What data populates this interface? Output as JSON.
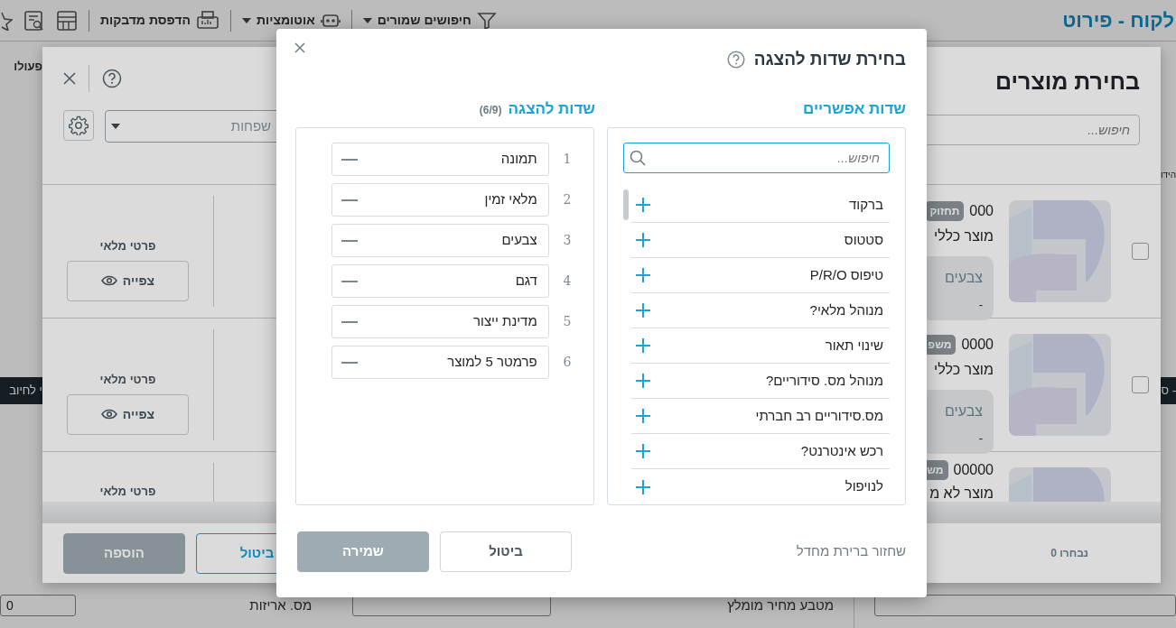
{
  "page": {
    "title": "לקוח - פירוט",
    "toolbar": [
      {
        "kind": "filter",
        "label": "חיפושים שמורים",
        "dropdown": true
      },
      {
        "kind": "robot",
        "label": "אוטומציות",
        "dropdown": true
      },
      {
        "kind": "printer",
        "label": "הדפסת מדבקות",
        "dropdown": false
      },
      {
        "kind": "table"
      },
      {
        "kind": "report"
      },
      {
        "kind": "star"
      }
    ],
    "left_tab": "פעולו",
    "left_banner": "י לחיוב",
    "right_label": "הידו",
    "right_banner": "- ס",
    "footer_fields": [
      {
        "label": "מטבע מחיר מומלץ"
      },
      {
        "label": "מס. אריזות",
        "value": "0"
      }
    ]
  },
  "product_picker": {
    "title": "בחירת מוצרים",
    "search": {
      "placeholder": "חיפוש..."
    },
    "family": {
      "placeholder": "שפחות"
    },
    "rows": [
      {
        "checked": false,
        "code": "000",
        "tag": "תחזוק",
        "name": "מוצר כללי",
        "attr_label": "צבעים",
        "attr_value": "-",
        "stock_label": "פרטי מלאי",
        "view": "צפייה"
      },
      {
        "checked": false,
        "code": "0000",
        "tag": "משפ",
        "name": "מוצר כללי",
        "attr_label": "צבעים",
        "attr_value": "-",
        "stock_label": "פרטי מלאי",
        "view": "צפייה"
      },
      {
        "code": "00000",
        "tag": "מש",
        "name": "מוצר לא מ",
        "stock_label": "פרטי מלאי"
      }
    ],
    "selected_count": "נבחרו 0",
    "buttons": [
      {
        "label": "ביטול",
        "kind": "outline",
        "disabled": false
      },
      {
        "label": "הוספה",
        "kind": "primary",
        "disabled": true
      }
    ]
  },
  "field_picker": {
    "title": "בחירת שדות להצגה",
    "available_title": "שדות אפשריים",
    "shown_title": "שדות להצגה",
    "shown_count": "(6/9)",
    "search": {
      "placeholder": "חיפוש..."
    },
    "available": [
      {
        "label": "ברקוד"
      },
      {
        "label": "סטטוס"
      },
      {
        "label": "טיפוס P/R/O"
      },
      {
        "label": "מנוהל מלאי?"
      },
      {
        "label": "שינוי תאור"
      },
      {
        "label": "מנוהל מס. סידוריים?"
      },
      {
        "label": "מס.סידוריים רב חברתי"
      },
      {
        "label": "רכש אינטרנט?"
      },
      {
        "label": "לנויפול"
      }
    ],
    "shown": [
      {
        "number": "1",
        "label": "תמונה"
      },
      {
        "number": "2",
        "label": "מלאי זמין"
      },
      {
        "number": "3",
        "label": "צבעים"
      },
      {
        "number": "4",
        "label": "דגם"
      },
      {
        "number": "5",
        "label": "מדינת ייצור"
      },
      {
        "number": "6",
        "label": "פרמטר 5 למוצר"
      }
    ],
    "reset": "שחזור ברירת מחדל",
    "buttons": [
      {
        "label": "ביטול",
        "kind": "outline",
        "disabled": false
      },
      {
        "label": "שמירה",
        "kind": "primary",
        "disabled": true
      }
    ]
  }
}
